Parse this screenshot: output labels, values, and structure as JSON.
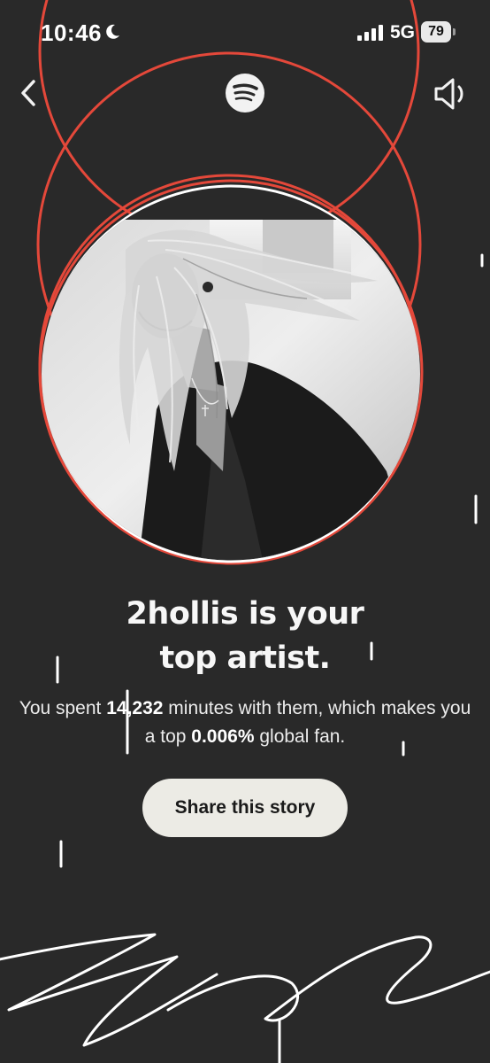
{
  "status_bar": {
    "time": "10:46",
    "network": "5G",
    "battery": "79"
  },
  "header": {
    "back_icon": "chevron-left-icon",
    "logo_icon": "spotify-logo-icon",
    "sound_icon": "speaker-icon"
  },
  "artist": {
    "photo_description_icon": "artist-photo"
  },
  "headline": {
    "line1": "2hollis is your",
    "line2": "top artist."
  },
  "summary": {
    "part1": "You spent ",
    "minutes": "14,232",
    "part2": " minutes with them, which makes you a top ",
    "percentile": "0.006%",
    "part3": " global fan."
  },
  "share": {
    "label": "Share this story"
  },
  "colors": {
    "background": "#292929",
    "accent_ring": "#e4483a",
    "button": "#ecebe5"
  }
}
